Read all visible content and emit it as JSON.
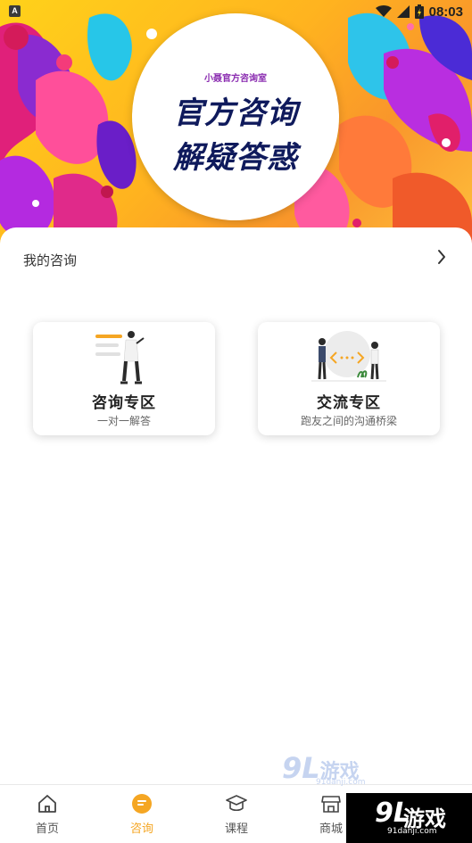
{
  "statusbar": {
    "indicator": "A",
    "time": "08:03"
  },
  "banner": {
    "subtitle": "小聂官方咨询室",
    "line1": "官方咨询",
    "line2": "解疑答惑"
  },
  "my_consult": {
    "title": "我的咨询",
    "arrow_icon": "chevron-right-icon"
  },
  "cards": [
    {
      "title": "咨询专区",
      "subtitle": "一对一解答",
      "icon": "consult-illustration"
    },
    {
      "title": "交流专区",
      "subtitle": "跑友之间的沟通桥梁",
      "icon": "exchange-illustration"
    }
  ],
  "tabs": [
    {
      "label": "首页",
      "icon": "home-icon",
      "active": false
    },
    {
      "label": "咨询",
      "icon": "chat-icon",
      "active": true
    },
    {
      "label": "课程",
      "icon": "graduation-cap-icon",
      "active": false
    },
    {
      "label": "商城",
      "icon": "store-icon",
      "active": false
    },
    {
      "label": "",
      "icon": "profile-icon",
      "active": false
    }
  ],
  "watermark": {
    "logo_number": "9L",
    "logo_text": "游戏",
    "site": "91danji.com",
    "site_small": "91danji.com"
  },
  "colors": {
    "accent": "#f5a623",
    "title_navy": "#0f1a5c",
    "subtitle_purple": "#8a2bb0"
  }
}
